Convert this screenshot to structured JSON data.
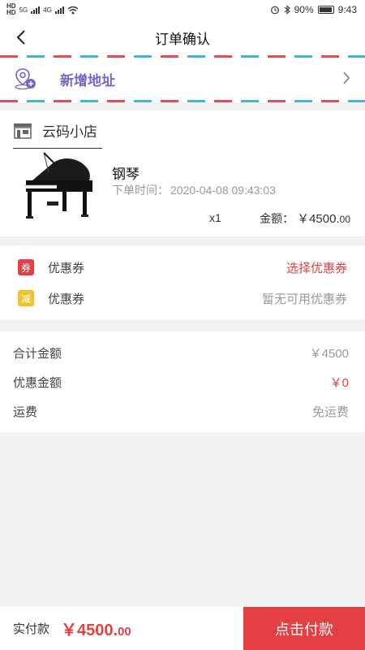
{
  "status_bar": {
    "network_left": "HD",
    "network_right": "5G",
    "network_b": "4G",
    "battery": "90%",
    "time": "9:43"
  },
  "nav": {
    "title": "订单确认"
  },
  "address": {
    "label": "新增地址"
  },
  "store": {
    "name": "云码小店",
    "product": {
      "name": "钢琴",
      "order_time_label": "下单时间：",
      "order_time": "2020-04-08 09:43:03",
      "quantity": "x1",
      "amount_label": "金额：",
      "amount_value": "￥4500.",
      "amount_cents": "00"
    }
  },
  "coupons": [
    {
      "badge": "券",
      "label": "优惠券",
      "action": "选择优惠券"
    },
    {
      "badge": "减",
      "label": "优惠券",
      "action": "暂无可用优惠券"
    }
  ],
  "summary": {
    "total_label": "合计金额",
    "total_value": "￥4500",
    "discount_label": "优惠金额",
    "discount_value": "￥0",
    "shipping_label": "运费",
    "shipping_value": "免运费"
  },
  "footer": {
    "pay_label": "实付款",
    "pay_amount": "￥4500.",
    "pay_cents": "00",
    "pay_button": "点击付款"
  },
  "colors": {
    "accent_red": "#e44044",
    "address_purple": "#7866cc",
    "stripe_blue": "#43b5d3",
    "badge_yellow": "#f1c22b"
  }
}
